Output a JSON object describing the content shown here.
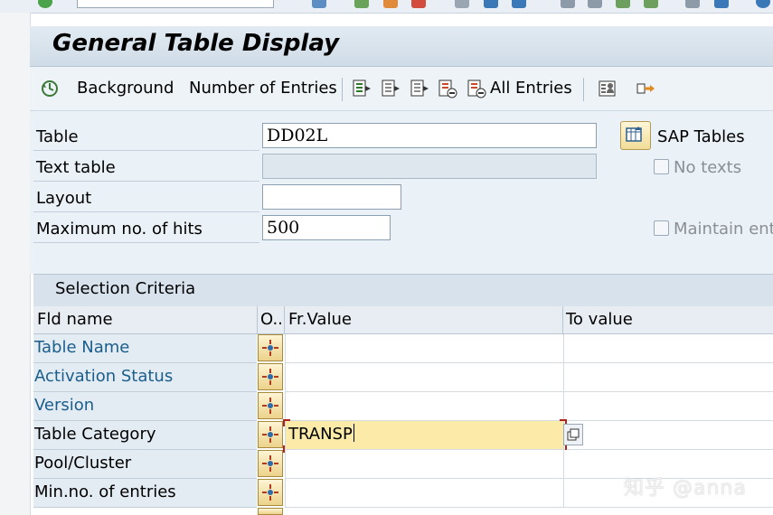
{
  "title": "General Table Display",
  "toolbar": {
    "background": "Background",
    "number_of_entries": "Number of Entries",
    "all_entries": "All Entries"
  },
  "form": {
    "table_label": "Table",
    "table_value": "DD02L",
    "text_table_label": "Text table",
    "text_table_value": "",
    "layout_label": "Layout",
    "layout_value": "",
    "max_hits_label": "Maximum no. of hits",
    "max_hits_value": "500",
    "sap_tables_label": "SAP Tables",
    "no_texts_label": "No texts",
    "maintain_entries_label": "Maintain entr"
  },
  "selection": {
    "header": "Selection Criteria",
    "columns": {
      "fld_name": "Fld name",
      "option": "O..",
      "from_value": "Fr.Value",
      "to_value": "To value"
    },
    "rows": [
      {
        "label": "Table Name",
        "from": "",
        "to": ""
      },
      {
        "label": "Activation Status",
        "from": "",
        "to": ""
      },
      {
        "label": "Version",
        "from": "",
        "to": ""
      },
      {
        "label": "Table Category",
        "from": "TRANSP",
        "to": ""
      },
      {
        "label": "Pool/Cluster",
        "from": "",
        "to": ""
      },
      {
        "label": "Min.no. of entries",
        "from": "",
        "to": ""
      }
    ]
  },
  "watermark": "知乎 @anna",
  "colors": {
    "link": "#1b5e8c",
    "active_cell": "#fbeaa8",
    "title_bar": "#d6e1eb"
  }
}
